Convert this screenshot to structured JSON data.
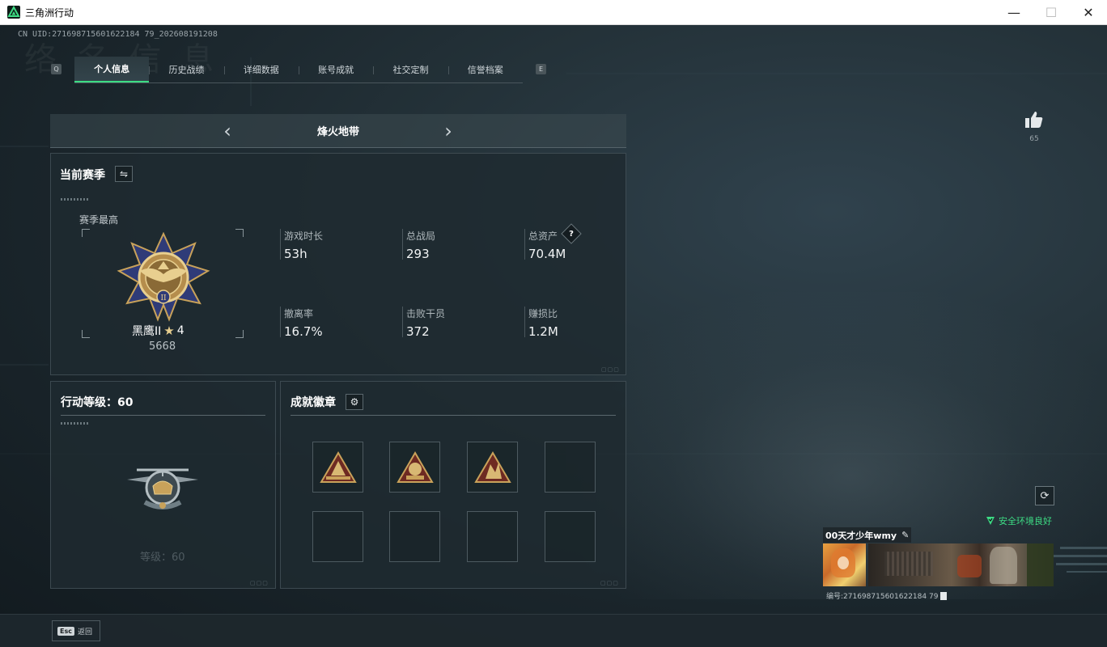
{
  "window": {
    "title": "三角洲行动",
    "minimize": "—",
    "maximize": "☐",
    "close": "✕"
  },
  "uid": "CN UID:271698715601622184 79_202608191208",
  "bg_ghost": "络 名 信 息",
  "tabs": [
    {
      "label": "个人信息",
      "active": true
    },
    {
      "label": "历史战绩"
    },
    {
      "label": "详细数据"
    },
    {
      "label": "账号成就"
    },
    {
      "label": "社交定制"
    },
    {
      "label": "信誉档案"
    }
  ],
  "tab_keys": {
    "left": "Q",
    "right": "E"
  },
  "mode": {
    "title": "烽火地带",
    "prev": "‹",
    "next": "›"
  },
  "season": {
    "title": "当前赛季",
    "switch_icon": "⇋",
    "best_label": "赛季最高",
    "rank_name": "黑鹰II",
    "rank_stars": "4",
    "rank_score": "5668",
    "stats": [
      {
        "label": "游戏时长",
        "value": "53h"
      },
      {
        "label": "总战局",
        "value": "293"
      },
      {
        "label": "总资产",
        "value": "70.4M",
        "help": "?"
      },
      {
        "label": "撤离率",
        "value": "16.7%"
      },
      {
        "label": "击败干员",
        "value": "372"
      },
      {
        "label": "赚损比",
        "value": "1.2M"
      }
    ]
  },
  "level": {
    "title": "行动等级：60",
    "caption": "等级：60"
  },
  "achievements": {
    "title": "成就徽章",
    "settings_icon": "⚙"
  },
  "like": {
    "count": "65"
  },
  "profile": {
    "safe_status": "安全环境良好",
    "name": "00天才少年wmy",
    "id_line": "编号:271698715601622184 79"
  },
  "bottom": {
    "esc_key": "Esc",
    "esc_label": "返回"
  },
  "colors": {
    "accent": "#3ddc84",
    "gold": "#c9a25a"
  }
}
